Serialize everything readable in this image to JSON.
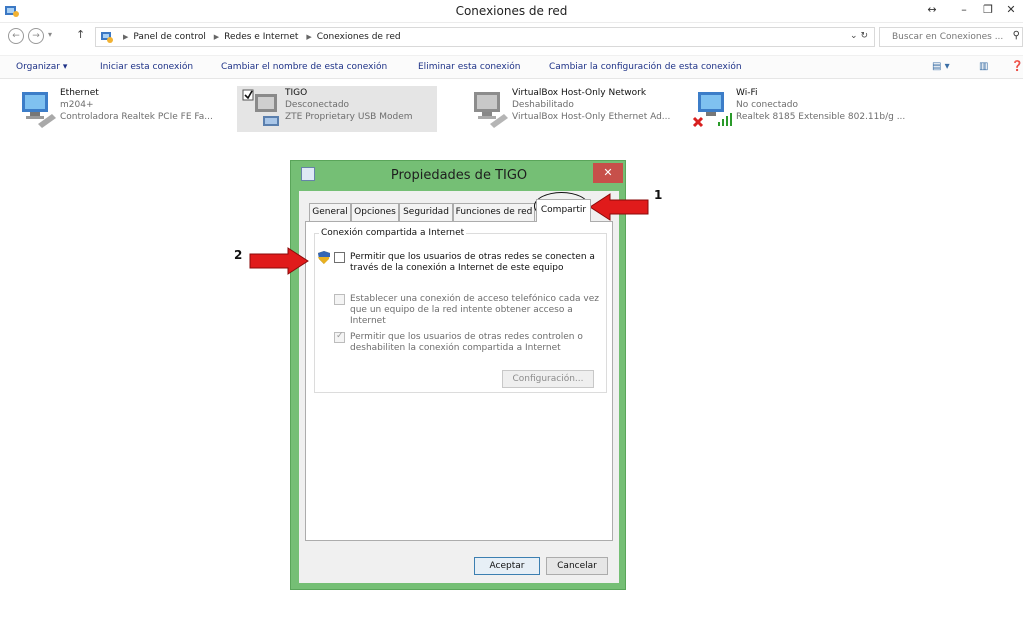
{
  "window": {
    "title": "Conexiones de red",
    "controls": {
      "resize": "↔",
      "minimize": "–",
      "restore": "❐",
      "close": "✕"
    }
  },
  "nav": {
    "back": "←",
    "forward": "→",
    "recent": "▾",
    "up": "↑",
    "breadcrumb": [
      "Panel de control",
      "Redes e Internet",
      "Conexiones de red"
    ],
    "refresh": "⌄   ↻",
    "search_placeholder": "Buscar en Conexiones ...",
    "search_icon": "⚲"
  },
  "toolbar": {
    "organizar": "Organizar ▾",
    "iniciar": "Iniciar esta conexión",
    "cambiar_nombre": "Cambiar el nombre de esta conexión",
    "eliminar": "Eliminar esta conexión",
    "cambiar_config": "Cambiar la configuración de esta conexión",
    "view_icon": "▤ ▾",
    "pane_icon": "▥",
    "help_icon": "❓"
  },
  "connections": [
    {
      "name": "Ethernet",
      "status": "m204+",
      "device": "Controladora Realtek PCIe FE Fa...",
      "icon": "ethernet-icon"
    },
    {
      "name": "TIGO",
      "status": "Desconectado",
      "device": "ZTE Proprietary USB Modem",
      "icon": "modem-icon"
    },
    {
      "name": "VirtualBox Host-Only Network",
      "status": "Deshabilitado",
      "device": "VirtualBox Host-Only Ethernet Ad...",
      "icon": "ethernet-icon"
    },
    {
      "name": "Wi-Fi",
      "status": "No conectado",
      "device": "Realtek 8185 Extensible 802.11b/g ...",
      "icon": "wifi-icon"
    }
  ],
  "dialog": {
    "title": "Propiedades de TIGO",
    "close": "✕",
    "tabs": [
      "General",
      "Opciones",
      "Seguridad",
      "Funciones de red",
      "Compartir"
    ],
    "active_tab": "Compartir",
    "group_label": "Conexión compartida a Internet",
    "options": [
      {
        "text": "Permitir que los usuarios de otras redes se conecten a través de la conexión a Internet de este equipo",
        "checked": false,
        "enabled": true
      },
      {
        "text": "Establecer una conexión de acceso telefónico cada vez que un equipo de la red intente obtener acceso a Internet",
        "checked": false,
        "enabled": false
      },
      {
        "text": "Permitir que los usuarios de otras redes controlen o deshabiliten la conexión compartida a Internet",
        "checked": true,
        "enabled": false
      }
    ],
    "check_mark": "✓",
    "config_button": "Configuración...",
    "ok_button": "Aceptar",
    "cancel_button": "Cancelar"
  },
  "annotations": {
    "label_1": "1",
    "label_2": "2",
    "arrow_color": "#e01b1b"
  }
}
